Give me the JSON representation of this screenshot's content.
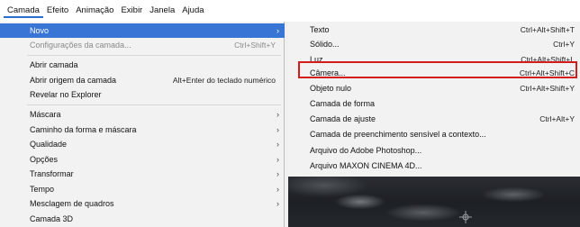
{
  "menubar": {
    "items": [
      "Camada",
      "Efeito",
      "Animação",
      "Exibir",
      "Janela",
      "Ajuda"
    ]
  },
  "menu": {
    "items": [
      {
        "label": "Novo",
        "shortcut": "",
        "submenu": true
      },
      {
        "label": "Configurações da camada...",
        "shortcut": "Ctrl+Shift+Y"
      },
      {
        "label": "Abrir camada",
        "shortcut": ""
      },
      {
        "label": "Abrir origem da camada",
        "shortcut": "Alt+Enter do teclado numérico"
      },
      {
        "label": "Revelar no Explorer",
        "shortcut": ""
      },
      {
        "label": "Máscara",
        "shortcut": "",
        "submenu": true
      },
      {
        "label": "Caminho da forma e máscara",
        "shortcut": "",
        "submenu": true
      },
      {
        "label": "Qualidade",
        "shortcut": "",
        "submenu": true
      },
      {
        "label": "Opções",
        "shortcut": "",
        "submenu": true
      },
      {
        "label": "Transformar",
        "shortcut": "",
        "submenu": true
      },
      {
        "label": "Tempo",
        "shortcut": "",
        "submenu": true
      },
      {
        "label": "Mesclagem de quadros",
        "shortcut": "",
        "submenu": true
      },
      {
        "label": "Camada 3D",
        "shortcut": ""
      }
    ]
  },
  "submenu": {
    "items": [
      {
        "label": "Texto",
        "shortcut": "Ctrl+Alt+Shift+T"
      },
      {
        "label": "Sólido...",
        "shortcut": "Ctrl+Y"
      },
      {
        "label": "Luz...",
        "shortcut": "Ctrl+Alt+Shift+L"
      },
      {
        "label": "Câmera...",
        "shortcut": "Ctrl+Alt+Shift+C"
      },
      {
        "label": "Objeto nulo",
        "shortcut": "Ctrl+Alt+Shift+Y"
      },
      {
        "label": "Camada de forma",
        "shortcut": ""
      },
      {
        "label": "Camada de ajuste",
        "shortcut": "Ctrl+Alt+Y"
      },
      {
        "label": "Camada de preenchimento sensível a contexto...",
        "shortcut": ""
      },
      {
        "label": "Arquivo do Adobe Photoshop...",
        "shortcut": ""
      },
      {
        "label": "Arquivo MAXON CINEMA 4D...",
        "shortcut": ""
      }
    ]
  },
  "colors": {
    "highlight": "#3975d4",
    "annotation_box": "#d31c1c"
  },
  "icons": {
    "submenu_arrow": "chevron-right-icon",
    "viewer_target": "crosshair-icon"
  }
}
